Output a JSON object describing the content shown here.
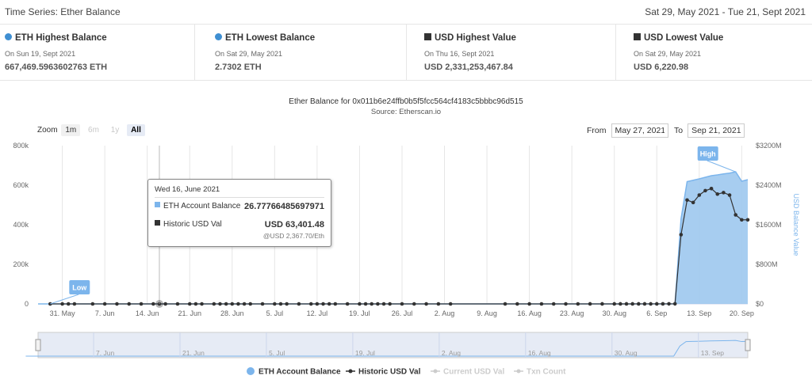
{
  "header": {
    "title": "Time Series: Ether Balance",
    "date_range": "Sat 29, May 2021 - Tue 21, Sept 2021"
  },
  "stats": [
    {
      "label": "ETH Highest Balance",
      "marker": "dot",
      "date": "On Sun 19, Sept 2021",
      "value": "667,469.5963602763 ETH"
    },
    {
      "label": "ETH Lowest Balance",
      "marker": "dot",
      "date": "On Sat 29, May 2021",
      "value": "2.7302 ETH"
    },
    {
      "label": "USD Highest Value",
      "marker": "square",
      "date": "On Thu 16, Sept 2021",
      "value": "USD 2,331,253,467.84"
    },
    {
      "label": "USD Lowest Value",
      "marker": "square",
      "date": "On Sat 29, May 2021",
      "value": "USD 6,220.98"
    }
  ],
  "controls": {
    "zoom_label": "Zoom",
    "zoom_buttons": [
      "1m",
      "6m",
      "1y",
      "All"
    ],
    "zoom_active": "All",
    "from_label": "From",
    "from_value": "May 27, 2021",
    "to_label": "To",
    "to_value": "Sep 21, 2021"
  },
  "tooltip": {
    "date": "Wed 16, June 2021",
    "balance_label": "ETH Account Balance",
    "balance_value": "26.77766485697971",
    "usd_label": "Historic USD Val",
    "usd_value": "USD 63,401.48",
    "rate_note": "@USD 2,367.70/Eth"
  },
  "colors": {
    "balance_fill": "#9dc8ee",
    "balance_line": "#7cb5ec",
    "usd_line": "#333333",
    "accent": "#3f8fd2"
  },
  "chart_data": {
    "type": "area",
    "title": "Ether Balance for 0x011b6e24ffb0b5f5fcc564cf4183c5bbbc96d515",
    "subtitle": "Source: Etherscan.io",
    "x_tick_labels": [
      "31. May",
      "7. Jun",
      "14. Jun",
      "21. Jun",
      "28. Jun",
      "5. Jul",
      "12. Jul",
      "19. Jul",
      "26. Jul",
      "2. Aug",
      "9. Aug",
      "16. Aug",
      "23. Aug",
      "30. Aug",
      "6. Sep",
      "13. Sep",
      "20. Sep"
    ],
    "y_left_ticks": [
      "0",
      "200k",
      "400k",
      "600k",
      "800k"
    ],
    "y_right_ticks": [
      "$0",
      "$800M",
      "$1600M",
      "$2400M",
      "$3200M"
    ],
    "ylabel_right": "USD Balance Value",
    "ylim_left": [
      0,
      800000
    ],
    "ylim_right": [
      0,
      3200000000
    ],
    "xlim": [
      "2021-05-27",
      "2021-09-21"
    ],
    "grid": "vertical",
    "legend_position": "bottom",
    "series": [
      {
        "name": "ETH Account Balance",
        "axis": "left",
        "x": [
          "2021-05-27",
          "2021-09-09",
          "2021-09-10",
          "2021-09-11",
          "2021-09-12",
          "2021-09-13",
          "2021-09-14",
          "2021-09-15",
          "2021-09-16",
          "2021-09-17",
          "2021-09-18",
          "2021-09-19",
          "2021-09-20",
          "2021-09-21"
        ],
        "values": [
          3,
          50,
          430000,
          618000,
          625000,
          632000,
          640000,
          648000,
          652000,
          657000,
          661000,
          667470,
          620000,
          628000
        ]
      },
      {
        "name": "Historic USD Val",
        "axis": "right",
        "x": [
          "2021-05-29",
          "2021-05-31",
          "2021-06-01",
          "2021-06-02",
          "2021-06-05",
          "2021-06-07",
          "2021-06-09",
          "2021-06-11",
          "2021-06-13",
          "2021-06-15",
          "2021-06-16",
          "2021-06-17",
          "2021-06-19",
          "2021-06-21",
          "2021-06-22",
          "2021-06-23",
          "2021-06-25",
          "2021-06-26",
          "2021-06-27",
          "2021-06-28",
          "2021-06-29",
          "2021-06-30",
          "2021-07-01",
          "2021-07-03",
          "2021-07-05",
          "2021-07-06",
          "2021-07-07",
          "2021-07-09",
          "2021-07-11",
          "2021-07-12",
          "2021-07-13",
          "2021-07-14",
          "2021-07-15",
          "2021-07-17",
          "2021-07-19",
          "2021-07-20",
          "2021-07-21",
          "2021-07-22",
          "2021-07-23",
          "2021-07-24",
          "2021-07-26",
          "2021-07-28",
          "2021-07-30",
          "2021-08-01",
          "2021-08-03",
          "2021-08-12",
          "2021-08-14",
          "2021-08-16",
          "2021-08-18",
          "2021-08-20",
          "2021-08-22",
          "2021-08-24",
          "2021-08-26",
          "2021-08-28",
          "2021-08-30",
          "2021-08-31",
          "2021-09-01",
          "2021-09-02",
          "2021-09-03",
          "2021-09-04",
          "2021-09-05",
          "2021-09-06",
          "2021-09-07",
          "2021-09-08",
          "2021-09-09",
          "2021-09-10",
          "2021-09-11",
          "2021-09-12",
          "2021-09-13",
          "2021-09-14",
          "2021-09-15",
          "2021-09-16",
          "2021-09-17",
          "2021-09-18",
          "2021-09-19",
          "2021-09-20",
          "2021-09-21"
        ],
        "values": [
          6220,
          8000,
          9000,
          10000,
          12000,
          14000,
          15000,
          16000,
          18000,
          20000,
          63401,
          30000,
          35000,
          40000,
          42000,
          45000,
          48000,
          50000,
          52000,
          55000,
          58000,
          60000,
          62000,
          65000,
          68000,
          70000,
          72000,
          75000,
          78000,
          80000,
          82000,
          85000,
          88000,
          90000,
          92000,
          94000,
          96000,
          98000,
          100000,
          102000,
          105000,
          108000,
          110000,
          115000,
          120000,
          130000,
          140000,
          150000,
          160000,
          170000,
          180000,
          200000,
          230000,
          270000,
          330000,
          400000,
          480000,
          560000,
          640000,
          720000,
          800000,
          900000,
          1000000,
          1150000,
          1500000,
          1400000000,
          2100000000,
          2050000000,
          2200000000,
          2290000000,
          2331253467,
          2220000000,
          2250000000,
          2200000000,
          1800000000,
          1700000000,
          1700000000
        ]
      },
      {
        "name": "Current USD Val",
        "visible": false
      },
      {
        "name": "Txn Count",
        "visible": false
      }
    ],
    "annotations": [
      {
        "text": "Low",
        "x": "2021-05-29",
        "series": "ETH Account Balance"
      },
      {
        "text": "High",
        "x": "2021-09-19",
        "series": "ETH Account Balance"
      }
    ],
    "navigator_tick_labels": [
      "7. Jun",
      "21. Jun",
      "5. Jul",
      "19. Jul",
      "2. Aug",
      "16. Aug",
      "30. Aug",
      "13. Sep"
    ]
  }
}
